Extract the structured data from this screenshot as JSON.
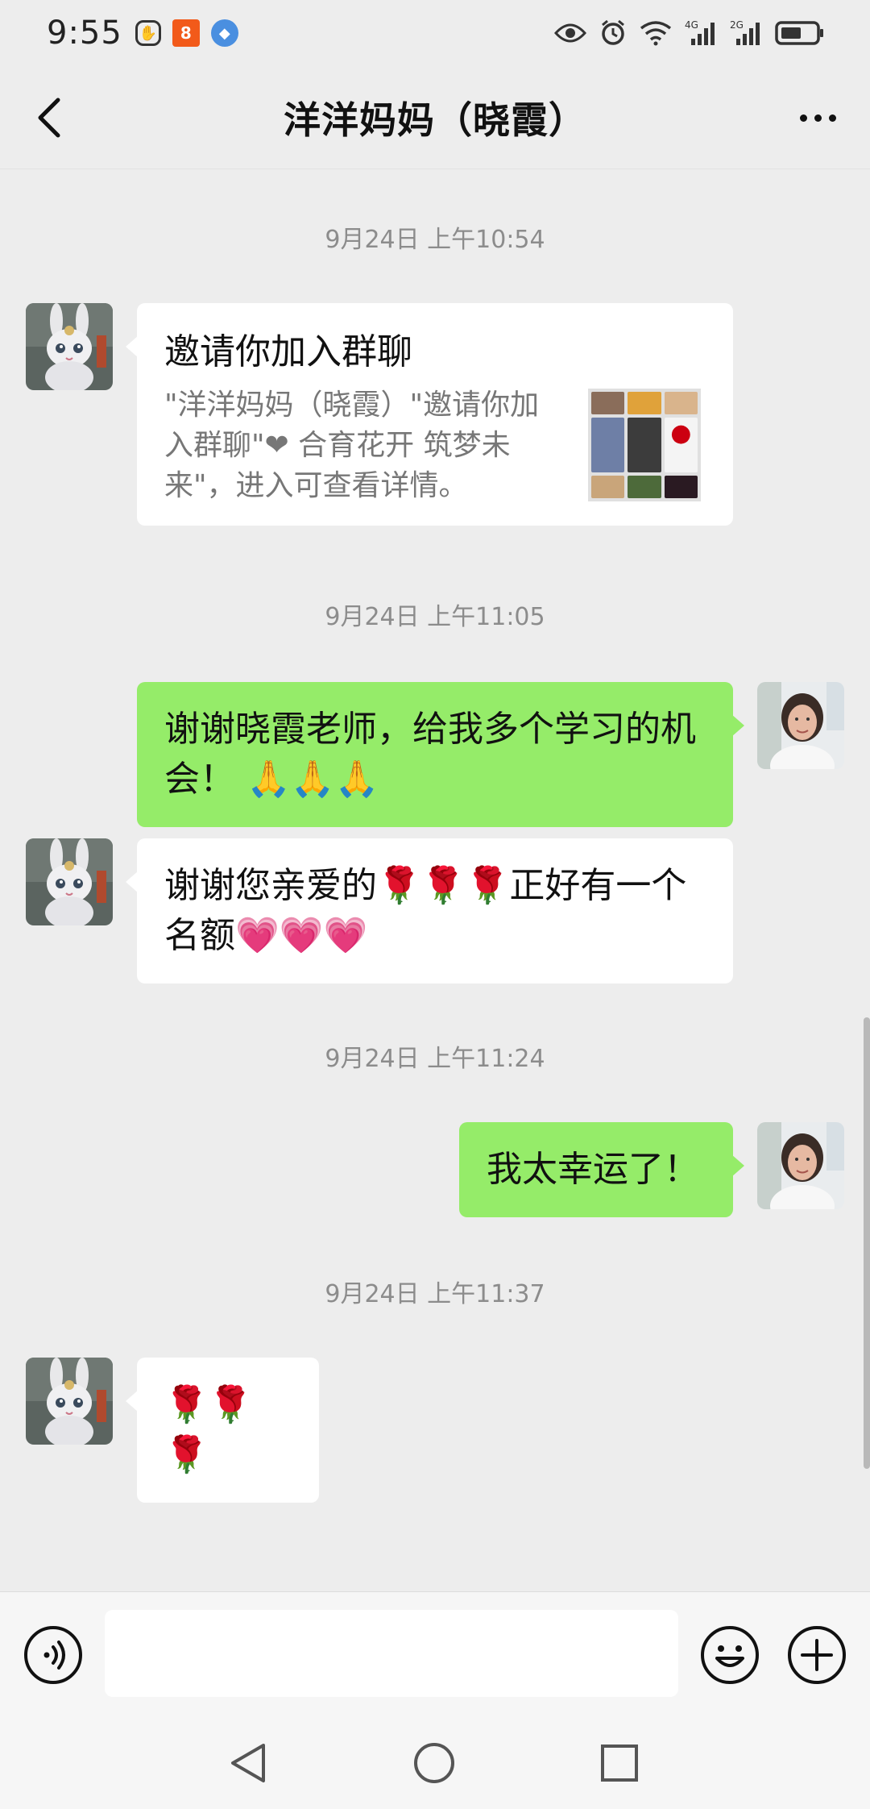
{
  "status_bar": {
    "time": "9:55",
    "left_icons": [
      "hand-icon",
      "app-orange-icon",
      "browser-icon"
    ],
    "right_icons": [
      "eye-icon",
      "alarm-icon",
      "wifi-icon",
      "signal-4g-icon",
      "signal-2g-icon",
      "battery-icon"
    ],
    "signal_4g_label": "4G",
    "signal_2g_label": "2G"
  },
  "header": {
    "title": "洋洋妈妈（晓霞）",
    "back_icon": "back-chevron-icon",
    "more_icon": "more-dots-icon"
  },
  "messages": [
    {
      "type": "timestamp",
      "text": "9月24日 上午10:54"
    },
    {
      "type": "invite_card",
      "direction": "in",
      "title": "邀请你加入群聊",
      "description_lines": [
        "\"洋洋妈妈（晓霞）\"邀请你加",
        "入群聊\"❤ 合育花开 筑梦未",
        "来\"，进入可查看详情。"
      ]
    },
    {
      "type": "timestamp",
      "text": "9月24日 上午11:05"
    },
    {
      "type": "text",
      "direction": "out",
      "lines": [
        "谢谢晓霞老师，给我多个学习的机",
        "会！"
      ],
      "emoji_suffix": "🙏🙏🙏"
    },
    {
      "type": "text",
      "direction": "in",
      "lines": [
        "谢谢您亲爱的🌹🌹🌹正好有一个",
        "名额"
      ],
      "emoji_suffix": "💗💗💗"
    },
    {
      "type": "timestamp",
      "text": "9月24日 上午11:24"
    },
    {
      "type": "text",
      "direction": "out",
      "lines": [
        "我太幸运了！"
      ]
    },
    {
      "type": "timestamp",
      "text": "9月24日 上午11:37"
    },
    {
      "type": "text",
      "direction": "in",
      "lines": [
        "🌹🌹🌹"
      ]
    }
  ],
  "input_bar": {
    "voice_icon": "voice-icon",
    "emoji_icon": "emoji-icon",
    "plus_icon": "plus-icon",
    "input_value": "",
    "input_placeholder": ""
  },
  "nav_bar": {
    "buttons": [
      "back-triangle-icon",
      "home-circle-icon",
      "recents-square-icon"
    ]
  },
  "colors": {
    "background": "#ededed",
    "outgoing_bubble": "#95ec69",
    "incoming_bubble": "#ffffff",
    "timestamp_text": "#8c8c8c"
  }
}
